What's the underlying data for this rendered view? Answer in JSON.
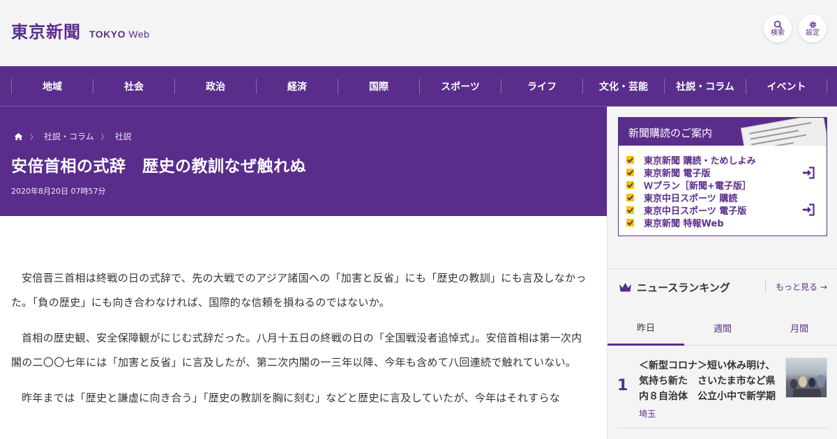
{
  "header": {
    "logo_text": "東京新聞",
    "logo_sub": "TOKYO",
    "logo_sub_web": "Web",
    "search_label": "検索",
    "settings_label": "設定"
  },
  "nav": {
    "items": [
      {
        "label": "地域"
      },
      {
        "label": "社会"
      },
      {
        "label": "政治"
      },
      {
        "label": "経済"
      },
      {
        "label": "国際"
      },
      {
        "label": "スポーツ"
      },
      {
        "label": "ライフ"
      },
      {
        "label": "文化・芸能"
      },
      {
        "label": "社説・コラム"
      },
      {
        "label": "イベント"
      }
    ]
  },
  "breadcrumb": {
    "items": [
      "社説・コラム",
      "社説"
    ]
  },
  "article": {
    "title": "安倍首相の式辞　歴史の教訓なぜ触れぬ",
    "date": "2020年8月20日 07時57分",
    "paragraphs": [
      "安倍晋三首相は終戦の日の式辞で、先の大戦でのアジア諸国への「加害と反省」にも「歴史の教訓」にも言及しなかった。「負の歴史」にも向き合わなければ、国際的な信頼を損ねるのではないか。",
      "首相の歴史観、安全保障観がにじむ式辞だった。八月十五日の終戦の日の「全国戦没者追悼式」。安倍首相は第一次内閣の二〇〇七年には「加害と反省」に言及したが、第二次内閣の一三年以降、今年も含めて八回連続で触れていない。",
      "昨年までは「歴史と謙虚に向き合う」「歴史の教訓を胸に刻む」などと歴史に言及していたが、今年はそれすらな"
    ]
  },
  "subscription": {
    "title": "新聞購読のご案内",
    "links": [
      {
        "label": "東京新聞 購読・ためしよみ"
      },
      {
        "label": "東京新聞 電子版"
      },
      {
        "label": "Ｗプラン［新聞+電子版］"
      },
      {
        "label": "東京中日スポーツ 購読"
      },
      {
        "label": "東京中日スポーツ 電子版"
      },
      {
        "label": "東京新聞 特報Web"
      }
    ]
  },
  "ranking": {
    "title": "ニュースランキング",
    "more_label": "もっと見る",
    "tabs": [
      {
        "label": "昨日"
      },
      {
        "label": "週間"
      },
      {
        "label": "月間"
      }
    ],
    "items": [
      {
        "rank": "1",
        "title": "＜新型コロナ＞短い休み明け、気持ち新た　さいたま市など県内８自治体　公立小中で新学期",
        "category": "埼玉"
      }
    ]
  },
  "colors": {
    "brand_purple": "#5a2d8c",
    "check_yellow": "#f5c400"
  }
}
